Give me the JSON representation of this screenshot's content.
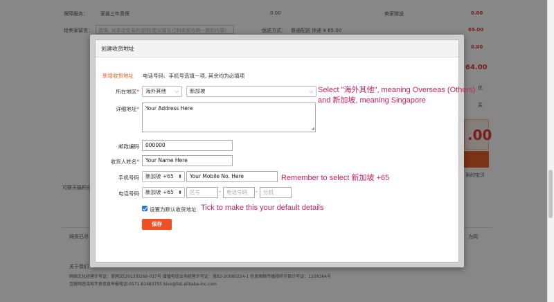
{
  "background": {
    "row1_label": "保障服务：",
    "row1_service": "家装三年质保",
    "row1_amount": "0.00",
    "row1_right_label": "卖家赠送",
    "row1_right_amount": "0.00",
    "row2_label": "给卖家留言：",
    "row2_placeholder": "选填: 对本次交易的说明(建议填写已和卖家协商一致的内容)",
    "row2_ship_label": "运送方式：",
    "row2_ship_value": "普通配送 快递 ¥ 65.00",
    "row2_amount": "65.00",
    "row3_amount": "0.00",
    "total_fragment": "64.00",
    "big_amount": ".00",
    "left_text_1": "可获天猫积分",
    "bottom_text_1": "网货已尽",
    "bottom_text_2": "方网",
    "footer_heading": "关于我们",
    "footer_line_1": "网络文化经营许可证：浙网文[2013]0268-027号 增值电信业务经营许可证：浙B2-20080224-1 信息网络传播视听节目许可证：1109364号",
    "footer_line_2": "互联网违法和不良信息举报电话:0571-81683755 blxx@list.alibaba-inc.com",
    "right_snip_1": "优",
    "right_snip_2": "买",
    "right_snip_3": "到的宝贝"
  },
  "dialog": {
    "title": "创建收货地址",
    "section_title": "新增收货地址",
    "hint": "电话号码、手机号选填一项, 其余均为必填项",
    "region_label": "所在地区",
    "region_select_1": "海外其他",
    "region_select_2": "新加坡",
    "address_label": "详细地址",
    "address_value": "Your Address Here",
    "postcode_label": "邮政编码",
    "postcode_value": "000000",
    "name_label": "收货人姓名",
    "name_value": "Your Name Here",
    "mobile_label": "手机号码",
    "mobile_country": "新加坡 +65",
    "mobile_value": "Your Mobile No. Here",
    "phone_label": "电话号码",
    "phone_country": "新加坡 +65",
    "phone_area_placeholder": "区号",
    "phone_number_placeholder": "电话号码",
    "phone_ext_placeholder": "分机",
    "default_checkbox_label": "设置为默认收货地址",
    "save_label": "保存",
    "required_mark": "*",
    "dash": "-"
  },
  "annotations": {
    "region_line1": "Select \"海外其他\", meaning Overseas (Others)",
    "region_line2": "and 新加坡, meaning Singapore",
    "mobile_note": "Remember to select 新加坡 +65",
    "default_note": "Tick to make this your default details"
  },
  "colors": {
    "accent": "#ef5025",
    "annotation": "#c8215a",
    "section_title": "#e8612c"
  }
}
